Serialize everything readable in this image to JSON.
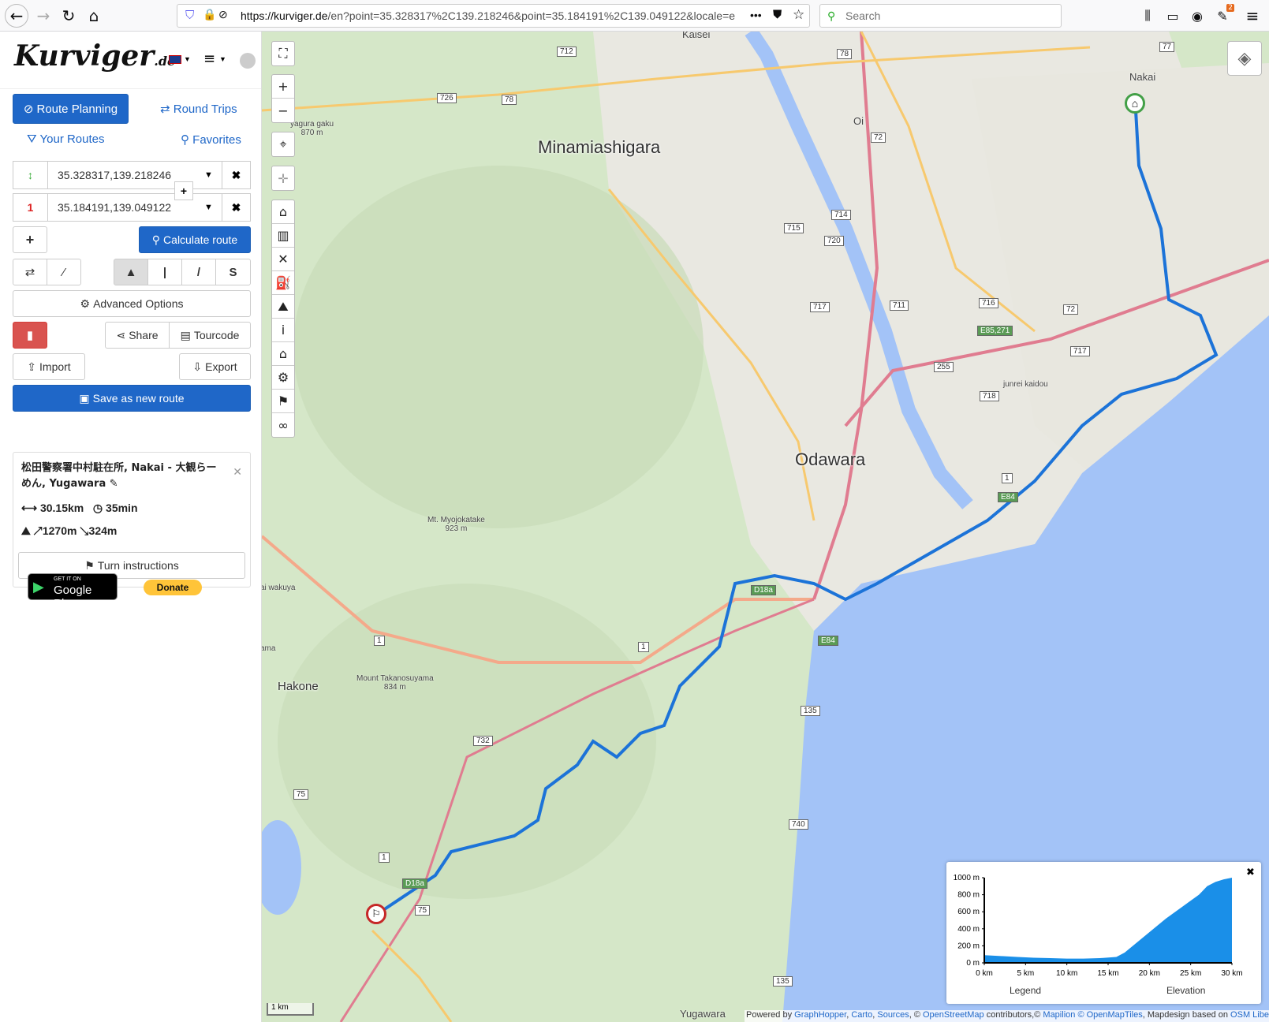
{
  "browser": {
    "url_host": "https://kurviger.de",
    "url_path": "/en?point=35.328317%2C139.218246&point=35.184191%2C139.049122&locale=e",
    "search_placeholder": "Search",
    "ellipsis": "•••",
    "notification_count": "2"
  },
  "app": {
    "logo_text": "Kurviger",
    "logo_suffix": ".de",
    "tabs": {
      "route_planning": "Route Planning",
      "round_trips": "Round Trips",
      "your_routes": "Your Routes",
      "favorites": "Favorites"
    },
    "waypoints": [
      {
        "marker": "↕",
        "value": "35.328317,139.218246"
      },
      {
        "marker": "1",
        "value": "35.184191,139.049122"
      }
    ],
    "add_label": "+",
    "calculate_label": "Calculate route",
    "advanced_label": "Advanced Options",
    "share_label": "Share",
    "tourcode_label": "Tourcode",
    "import_label": "Import",
    "export_label": "Export",
    "save_label": "Save as new route",
    "route": {
      "title": "松田警察署中村駐在所, Nakai - 大観らーめん, Yugawara",
      "distance": "30.15km",
      "duration": "35min",
      "ascent": "↗1270m",
      "descent": "↘324m",
      "turn_label": "Turn instructions"
    },
    "google_play_top": "GET IT ON",
    "google_play_bottom": "Google Play",
    "donate_label": "Donate"
  },
  "map": {
    "places": {
      "minamiashigara": "Minamiashigara",
      "odawara": "Odawara",
      "hakone": "Hakone",
      "nakai": "Nakai",
      "kaisei": "Kaisei",
      "oi": "Oi",
      "yugawara": "Yugawara",
      "yagura": "yagura gaku",
      "yagura_elev": "870 m",
      "myojo": "Mt. Myojokatake",
      "myojo_elev": "923 m",
      "takano": "Mount Takanosuyama",
      "takano_elev": "834 m",
      "wakuya": "ai wakuya",
      "ama": "ama",
      "junrei": "junrei kaidou"
    },
    "shields": [
      "712",
      "78",
      "726",
      "78",
      "72",
      "714",
      "715",
      "720",
      "717",
      "711",
      "716",
      "72",
      "E85,271",
      "717",
      "255",
      "718",
      "1",
      "E84",
      "1",
      "E84",
      "135",
      "732",
      "75",
      "1",
      "1",
      "740",
      "135",
      "D18a",
      "75",
      "77",
      "D18a"
    ],
    "scale": "1 km",
    "attribution": {
      "prefix": "Powered by ",
      "gh": "GraphHopper",
      "carto": "Carto",
      "sources": "Sources",
      "osm": "OpenStreetMap",
      "contrib": " contributors,© ",
      "mapilion": "Mapilion",
      "omt": "© OpenMapTiles",
      "mapdesign": ", Mapdesign based on ",
      "osmlib": "OSM Liberty"
    }
  },
  "elevation": {
    "y_ticks": [
      "1000 m",
      "800 m",
      "600 m",
      "400 m",
      "200 m",
      "0 m"
    ],
    "x_ticks": [
      "0 km",
      "5 km",
      "10 km",
      "15 km",
      "20 km",
      "25 km",
      "30 km"
    ],
    "legend": "Legend",
    "elevation_label": "Elevation",
    "close": "✖",
    "fill_color": "#1a8fe8"
  },
  "chart_data": {
    "type": "area",
    "xlabel": "",
    "ylabel": "",
    "x": [
      0,
      2,
      4,
      6,
      8,
      10,
      12,
      14,
      16,
      17,
      18,
      20,
      22,
      24,
      26,
      27,
      28,
      29,
      30
    ],
    "values": [
      90,
      80,
      70,
      60,
      55,
      50,
      50,
      55,
      70,
      120,
      200,
      360,
      520,
      660,
      800,
      900,
      950,
      980,
      1000
    ],
    "xlim": [
      0,
      30
    ],
    "ylim": [
      0,
      1000
    ]
  }
}
